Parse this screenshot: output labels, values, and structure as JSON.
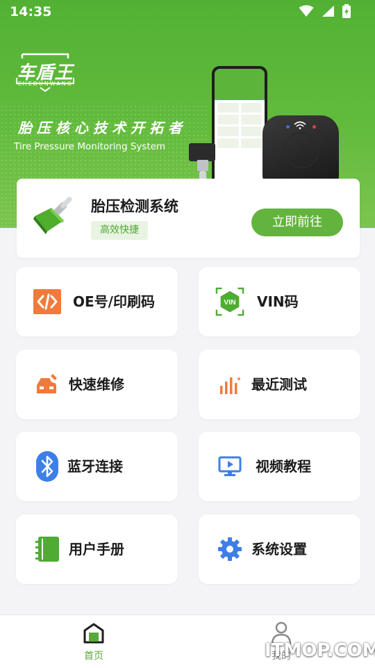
{
  "status_bar": {
    "time": "14:35",
    "icons": [
      "wifi-icon",
      "signal-icon",
      "battery-charging-icon"
    ]
  },
  "hero": {
    "logo_text": "车盾王",
    "logo_sub": "CHEDUNWANG",
    "slogan": "胎压核心技术开拓者",
    "slogan_en": "Tire Pressure Monitoring System"
  },
  "feature_card": {
    "title": "胎压检测系统",
    "tag": "高效快捷",
    "button": "立即前往"
  },
  "menu": [
    {
      "label": "OE号/印刷码",
      "icon": "code-icon",
      "color": "#f07a3c"
    },
    {
      "label": "VIN码",
      "icon": "vin-icon",
      "color": "#4fab34"
    },
    {
      "label": "快速维修",
      "icon": "repair-car-icon",
      "color": "#f07a3c"
    },
    {
      "label": "最近测试",
      "icon": "bar-chart-icon",
      "color": "#f07a3c"
    },
    {
      "label": "蓝牙连接",
      "icon": "bluetooth-icon",
      "color": "#3d7fe6"
    },
    {
      "label": "视频教程",
      "icon": "monitor-icon",
      "color": "#3d7fe6"
    },
    {
      "label": "用户手册",
      "icon": "manual-icon",
      "color": "#4fab34"
    },
    {
      "label": "系统设置",
      "icon": "gear-icon",
      "color": "#3d7fe6"
    }
  ],
  "bottom_nav": [
    {
      "label": "首页",
      "icon": "home-icon",
      "active": true
    },
    {
      "label": "我的",
      "icon": "user-icon",
      "active": false
    }
  ],
  "colors": {
    "brand_green": "#63b43f",
    "active_nav": "#5aa83b",
    "inactive_nav": "#8a8a8a"
  },
  "watermark": "ITMOP.COM"
}
